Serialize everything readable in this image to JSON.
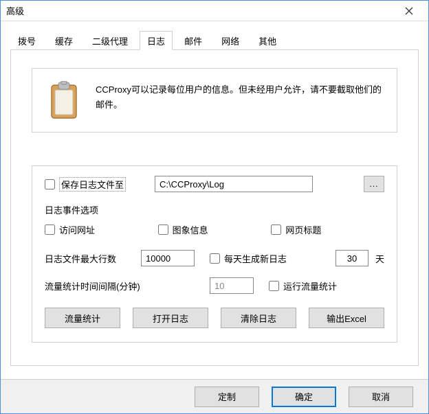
{
  "window": {
    "title": "高级"
  },
  "tabs": {
    "items": [
      "拨号",
      "缓存",
      "二级代理",
      "日志",
      "邮件",
      "网络",
      "其他"
    ],
    "active_index": 3
  },
  "info": {
    "text": "CCProxy可以记录每位用户的信息。但未经用户允许，请不要截取他们的邮件。"
  },
  "log": {
    "save_label": "保存日志文件至",
    "path": "C:\\CCProxy\\Log",
    "browse": "...",
    "events_label": "日志事件选项",
    "visit_url": "访问网址",
    "image_info": "图象信息",
    "page_title": "网页标题",
    "max_lines_label": "日志文件最大行数",
    "max_lines": "10000",
    "daily_new_label": "每天生成新日志",
    "days": "30",
    "days_unit": "天",
    "interval_label": "流量统计时间间隔(分钟)",
    "interval": "10",
    "run_stats_label": "运行流量统计"
  },
  "buttons": {
    "stats": "流量统计",
    "open_log": "打开日志",
    "clear_log": "清除日志",
    "export_excel": "输出Excel"
  },
  "footer": {
    "customize": "定制",
    "ok": "确定",
    "cancel": "取消"
  }
}
